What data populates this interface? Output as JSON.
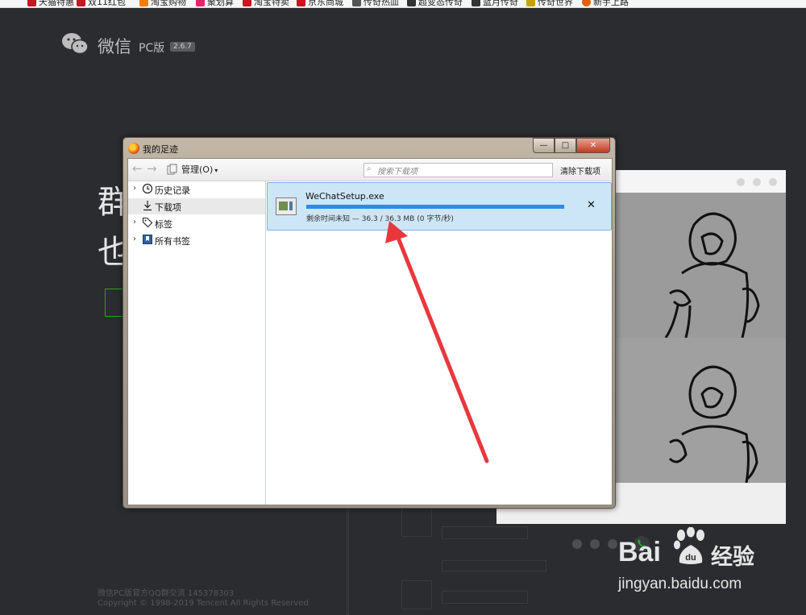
{
  "bookmarks": [
    "天猫特惠",
    "双11红包",
    "淘宝购物",
    "聚划算",
    "淘宝特卖",
    "京东商城",
    "传奇热血",
    "超变态传奇",
    "蓝月传奇",
    "传奇世界",
    "新手上路"
  ],
  "site": {
    "app_name": "微信",
    "edition": "PC版",
    "version": "2.6.7",
    "headline_1": "群",
    "headline_2": "也",
    "footer_1": "微信PC版官方QQ群交流 145378303",
    "footer_2": "Copyright © 1998-2019 Tencent All Rights Reserved"
  },
  "dialog": {
    "title": "我的足迹",
    "minimize": "—",
    "maximize": "□",
    "close": "✕",
    "toolbar": {
      "back": "←",
      "forward": "→",
      "manage": "管理(O)",
      "manage_arrow": "▾",
      "search_placeholder": "搜索下载项",
      "clear": "清除下载项"
    },
    "sidebar": {
      "items": [
        {
          "label": "历史记录",
          "expander": "›",
          "selected": false
        },
        {
          "label": "下载项",
          "expander": "",
          "selected": true
        },
        {
          "label": "标签",
          "expander": "›",
          "selected": false
        },
        {
          "label": "所有书签",
          "expander": "›",
          "selected": false
        }
      ]
    },
    "download": {
      "filename": "WeChatSetup.exe",
      "status": "剩余时间未知 — 36.3 / 36.3 MB (0 字节/秒)",
      "progress": 1.0,
      "cancel": "✕"
    }
  },
  "watermark": {
    "brand": "Bai",
    "brand2": "经验",
    "url": "jingyan.baidu.com"
  },
  "colors": {
    "accent": "#2e8be4",
    "arrow": "#e8383d",
    "wechat_green": "#1aad19"
  }
}
